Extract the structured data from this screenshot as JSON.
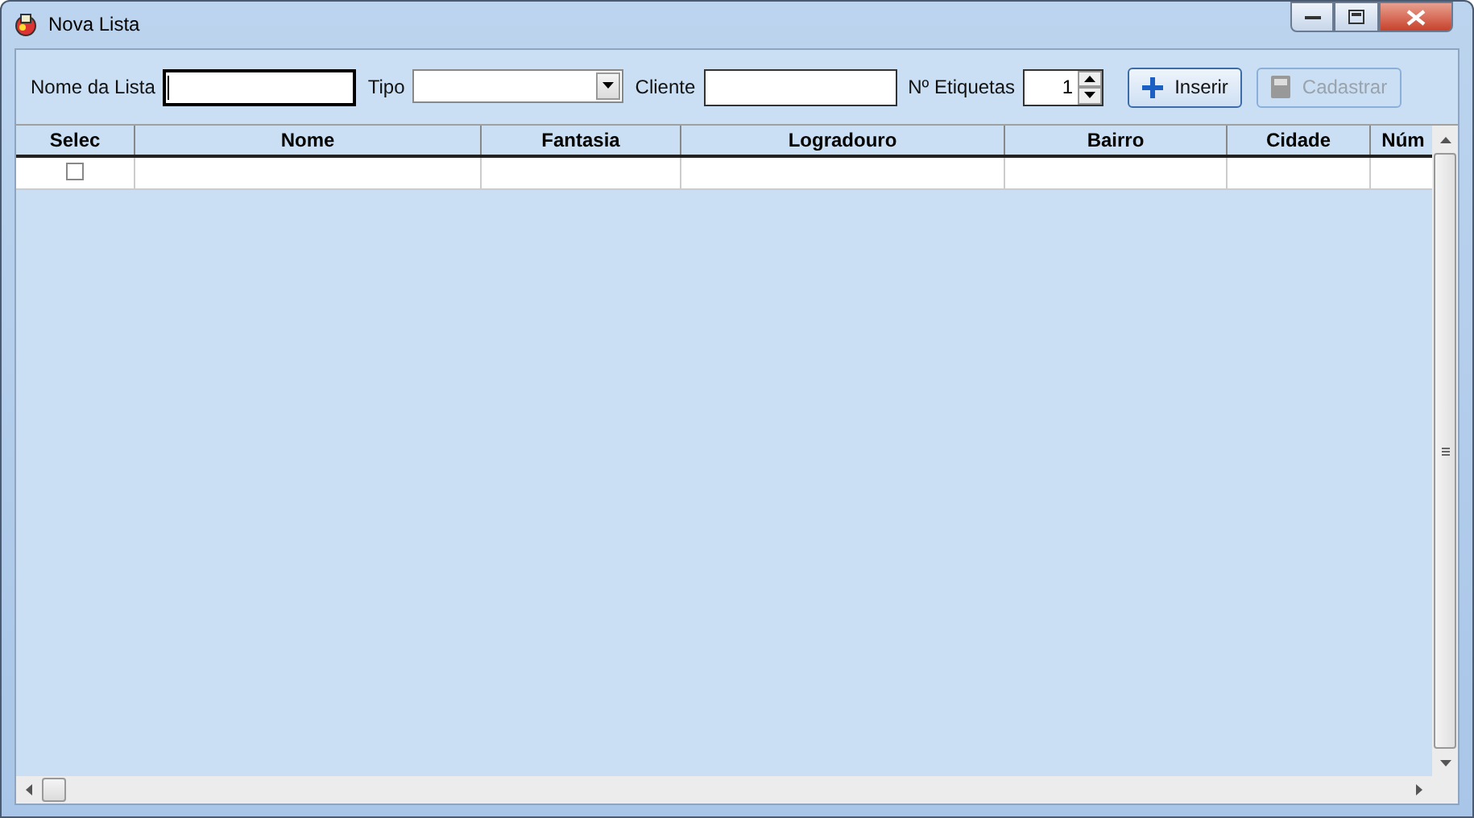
{
  "window": {
    "title": "Nova Lista"
  },
  "toolbar": {
    "fields": [
      {
        "kind": "text",
        "label": "Nome da Lista",
        "focused": true
      },
      {
        "kind": "combo",
        "label": "Tipo",
        "focused": false
      },
      {
        "kind": "text",
        "label": "Cliente",
        "focused": false
      },
      {
        "kind": "spin",
        "label": "Nº Etiquetas",
        "value": "1",
        "focused": false
      }
    ],
    "buttons": [
      {
        "kind": "add",
        "label": "Inserir",
        "disabled": false
      },
      {
        "kind": "save",
        "label": "Cadastrar",
        "disabled": true
      }
    ]
  },
  "table": {
    "columns": [
      "Selec",
      "Nome",
      "Fantasia",
      "Logradouro",
      "Bairro",
      "Cidade",
      "Núm"
    ],
    "rows": [
      {
        "checked": false
      }
    ]
  }
}
